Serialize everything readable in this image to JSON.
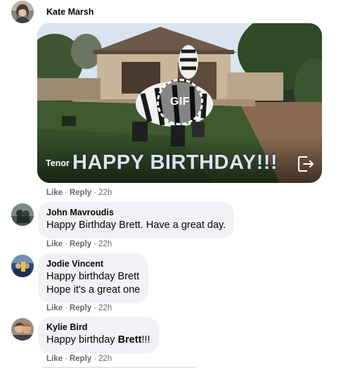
{
  "top_comment": {
    "author": "Kate Marsh",
    "gif": {
      "provider": "Tenor",
      "badge": "GIF",
      "caption": "HAPPY BIRTHDAY!!!"
    },
    "actions": {
      "like": "Like",
      "reply": "Reply",
      "time": "22h"
    }
  },
  "comments": [
    {
      "author": "John Mavroudis",
      "lines": [
        "Happy Birthday Brett. Have a great day."
      ],
      "actions": {
        "like": "Like",
        "reply": "Reply",
        "time": "22h"
      }
    },
    {
      "author": "Jodie Vincent",
      "lines": [
        "Happy birthday Brett",
        "Hope it's a great one"
      ],
      "actions": {
        "like": "Like",
        "reply": "Reply",
        "time": "22h"
      }
    },
    {
      "author": "Kylie Bird",
      "text_prefix": "Happy birthday ",
      "mention": "Brett",
      "text_suffix": "!!!",
      "actions": {
        "like": "Like",
        "reply": "Reply",
        "time": "22h"
      }
    }
  ],
  "separator": "·",
  "colors": {
    "bubble": "#f0f2f5",
    "meta_text": "#65676b",
    "name_text": "#050505"
  }
}
